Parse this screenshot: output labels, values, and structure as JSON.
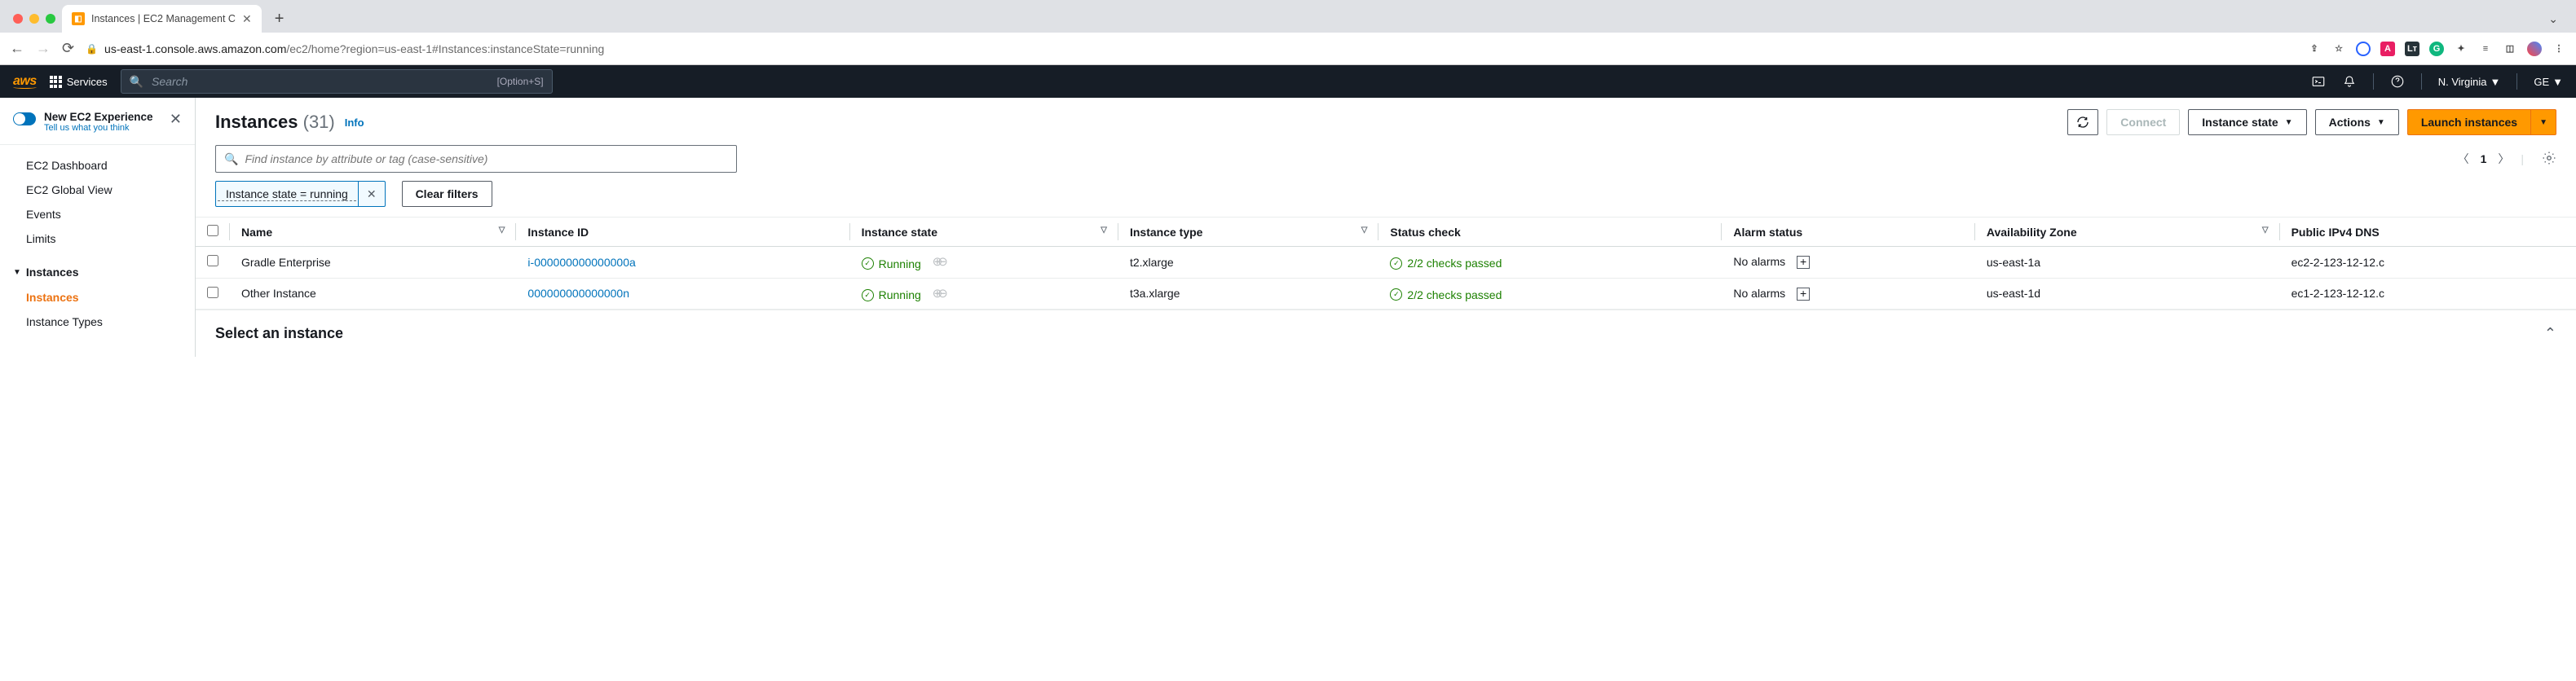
{
  "browser": {
    "tab_title": "Instances | EC2 Management C",
    "url_host": "us-east-1.console.aws.amazon.com",
    "url_path": "/ec2/home?region=us-east-1#Instances:instanceState=running"
  },
  "aws_nav": {
    "services_label": "Services",
    "search_placeholder": "Search",
    "kbd_hint": "[Option+S]",
    "region": "N. Virginia",
    "account": "GE"
  },
  "sidebar": {
    "new_experience_title": "New EC2 Experience",
    "new_experience_sub": "Tell us what you think",
    "items_top": [
      "EC2 Dashboard",
      "EC2 Global View",
      "Events",
      "Limits"
    ],
    "group_header": "Instances",
    "items_instances": [
      "Instances",
      "Instance Types"
    ]
  },
  "header": {
    "title": "Instances",
    "count": "(31)",
    "info": "Info",
    "refresh_aria": "Refresh",
    "connect": "Connect",
    "instance_state": "Instance state",
    "actions": "Actions",
    "launch": "Launch instances"
  },
  "filter": {
    "placeholder": "Find instance by attribute or tag (case-sensitive)",
    "chip_label": "Instance state = running",
    "clear_filters": "Clear filters",
    "page_num": "1"
  },
  "table": {
    "columns": [
      "Name",
      "Instance ID",
      "Instance state",
      "Instance type",
      "Status check",
      "Alarm status",
      "Availability Zone",
      "Public IPv4 DNS"
    ],
    "rows": [
      {
        "name": "Gradle Enterprise",
        "instance_id": "i-000000000000000a",
        "state": "Running",
        "type": "t2.xlarge",
        "status_check": "2/2 checks passed",
        "alarm": "No alarms",
        "az": "us-east-1a",
        "dns": "ec2-2-123-12-12.c"
      },
      {
        "name": "Other Instance",
        "instance_id": "000000000000000n",
        "state": "Running",
        "type": "t3a.xlarge",
        "status_check": "2/2 checks passed",
        "alarm": "No alarms",
        "az": "us-east-1d",
        "dns": "ec1-2-123-12-12.c"
      }
    ]
  },
  "detail": {
    "title": "Select an instance"
  }
}
